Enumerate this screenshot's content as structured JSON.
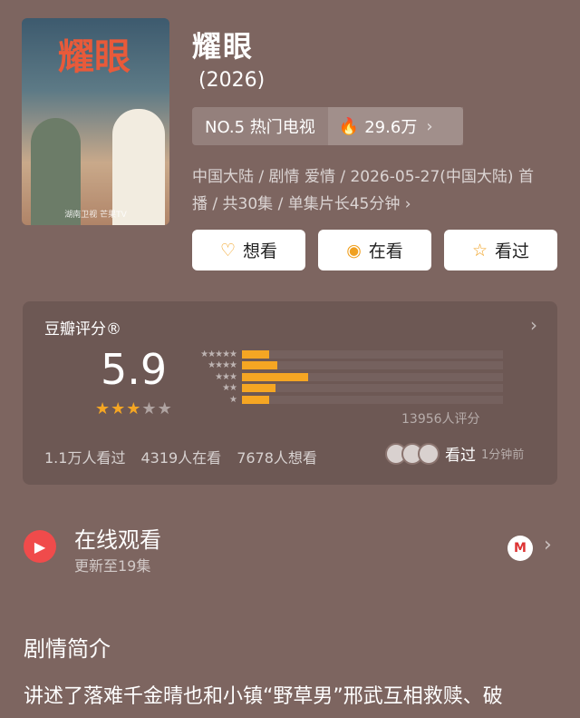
{
  "poster": {
    "sign": "耀眼",
    "caption": "湖南卫视 芒果TV"
  },
  "title": "耀眼",
  "year": "(2026)",
  "rank": {
    "label": "NO.5 热门电视",
    "heat": "29.6万",
    "flame_icon": "flame-icon"
  },
  "meta": {
    "line1": "中国大陆 / 剧情 爱情 / 2026-05-27(中国大陆) 首",
    "line2": "播 / 共30集 / 单集片长45分钟"
  },
  "buttons": {
    "want": "想看",
    "watching": "在看",
    "watched": "看过"
  },
  "rating": {
    "label": "豆瓣评分®",
    "score": "5.9",
    "stars_on": 3,
    "count_text": "13956人评分",
    "distribution": [
      0.14,
      0.18,
      0.34,
      0.17,
      0.14
    ],
    "stats": {
      "watched": "1.1万人看过",
      "watching": "4319人在看",
      "want": "7678人想看"
    },
    "recent_label": "看过",
    "recent_time": "1分钟前"
  },
  "online": {
    "title": "在线观看",
    "subtitle": "更新至19集"
  },
  "intro": {
    "heading": "剧情简介",
    "text": "讲述了落难千金晴也和小镇“野草男”邢武互相救赎、破"
  },
  "colors": {
    "accent": "#f5a623",
    "play": "#f04b4b",
    "background": "#7d6560"
  }
}
